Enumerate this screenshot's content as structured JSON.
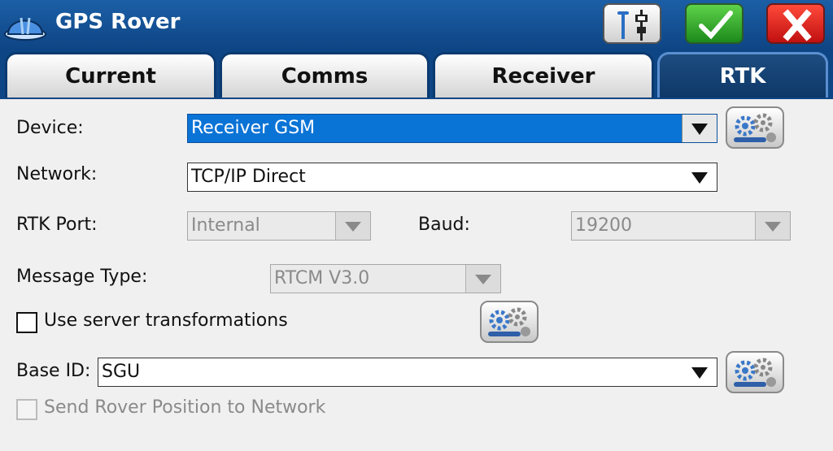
{
  "window": {
    "title": "GPS Rover"
  },
  "titlebar_buttons": [
    {
      "name": "rover-config-icon"
    },
    {
      "name": "checkmark-icon",
      "color": "#2e9e2e"
    },
    {
      "name": "close-icon",
      "color": "#d21a1a"
    }
  ],
  "tabs": [
    {
      "label": "Current",
      "active": false
    },
    {
      "label": "Comms",
      "active": false
    },
    {
      "label": "Receiver",
      "active": false
    },
    {
      "label": "RTK",
      "active": true
    }
  ],
  "form": {
    "device": {
      "label": "Device:",
      "value": "Receiver GSM"
    },
    "network": {
      "label": "Network:",
      "value": "TCP/IP Direct"
    },
    "rtk_port": {
      "label": "RTK Port:",
      "value": "Internal"
    },
    "baud": {
      "label": "Baud:",
      "value": "19200"
    },
    "message_type": {
      "label": "Message Type:",
      "value": "RTCM V3.0"
    },
    "use_server_transformations": {
      "label": "Use server transformations",
      "checked": false
    },
    "base_id": {
      "label": "Base ID:",
      "value": "SGU"
    },
    "send_rover_position": {
      "label": "Send Rover Position to Network",
      "checked": false,
      "enabled": false
    }
  },
  "colors": {
    "titlebar": "#1258a0",
    "selection": "#0a73d6",
    "accent_tab": "#0e3868"
  }
}
